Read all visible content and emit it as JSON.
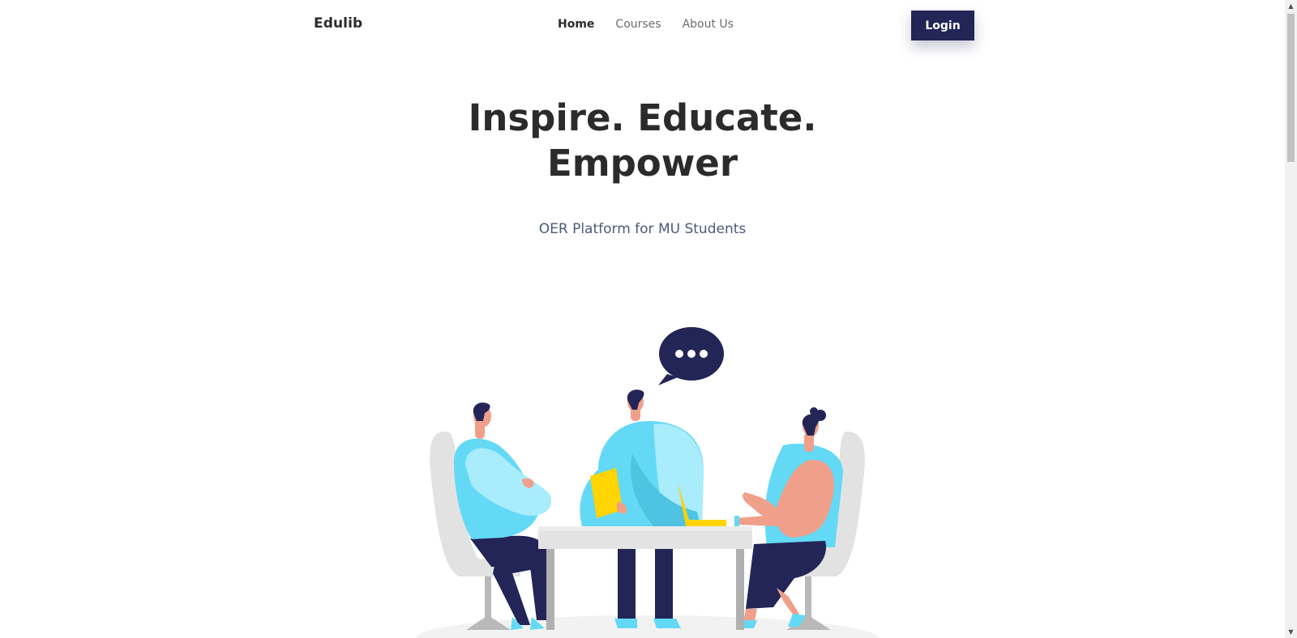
{
  "navbar": {
    "brand": "Edulib",
    "links": [
      {
        "label": "Home",
        "active": true
      },
      {
        "label": "Courses",
        "active": false
      },
      {
        "label": "About Us",
        "active": false
      }
    ],
    "login_label": "Login"
  },
  "hero": {
    "title_line1": "Inspire. Educate.",
    "title_line2": "Empower",
    "subtitle": "OER Platform for MU Students"
  },
  "colors": {
    "primary": "#232557",
    "text": "#2b2b2b",
    "subtitle": "#4c5a78",
    "shirt_light": "#a9ecfb",
    "shirt": "#63d9f5",
    "accent_yellow": "#ffd400",
    "skin": "#f0a08a"
  },
  "icons": {
    "speech_bubble": "chat-dots-icon",
    "scroll_up": "triangle-up-icon",
    "scroll_down": "triangle-down-icon"
  }
}
